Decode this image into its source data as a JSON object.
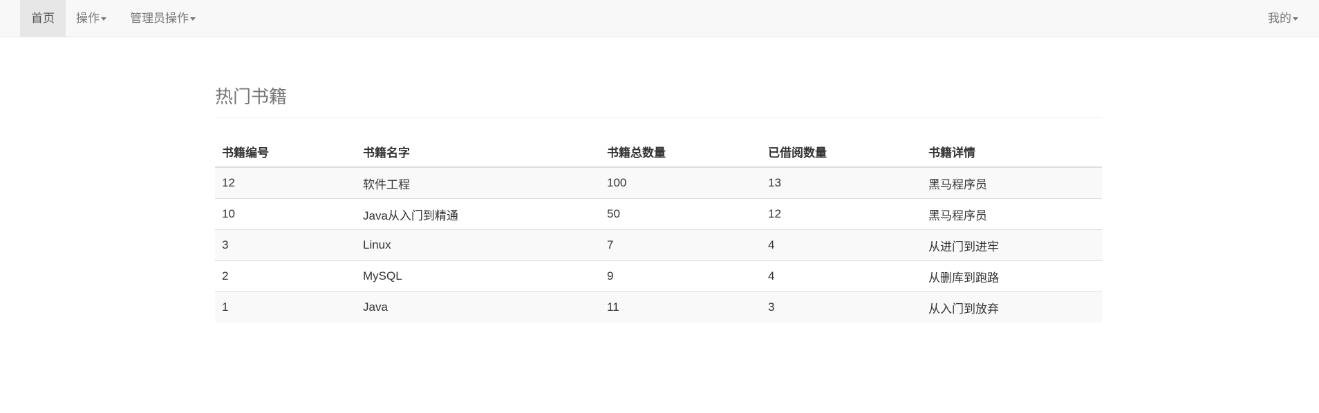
{
  "navbar": {
    "items": [
      {
        "label": "首页",
        "active": true
      },
      {
        "label": "操作",
        "dropdown": true
      },
      {
        "label": "管理员操作",
        "dropdown": true
      }
    ],
    "right": {
      "label": "我的",
      "dropdown": true
    }
  },
  "page": {
    "title": "热门书籍"
  },
  "table": {
    "headers": [
      "书籍编号",
      "书籍名字",
      "书籍总数量",
      "已借阅数量",
      "书籍详情"
    ],
    "rows": [
      [
        "12",
        "软件工程",
        "100",
        "13",
        "黑马程序员"
      ],
      [
        "10",
        "Java从入门到精通",
        "50",
        "12",
        "黑马程序员"
      ],
      [
        "3",
        "Linux",
        "7",
        "4",
        "从进门到进牢"
      ],
      [
        "2",
        "MySQL",
        "9",
        "4",
        "从删库到跑路"
      ],
      [
        "1",
        "Java",
        "11",
        "3",
        "从入门到放弃"
      ]
    ]
  }
}
